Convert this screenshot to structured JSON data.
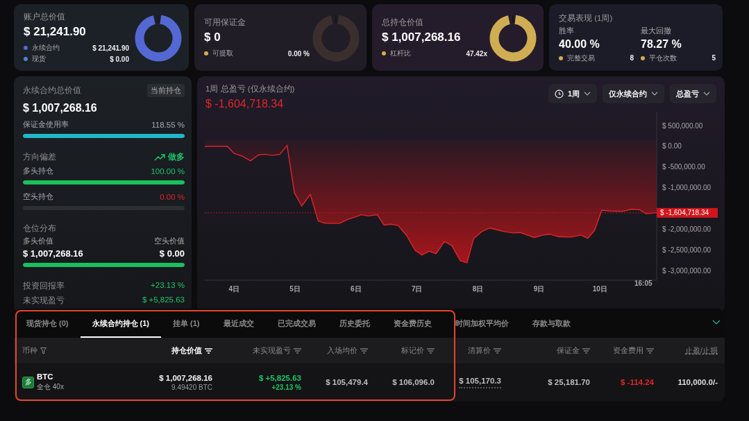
{
  "cards": [
    {
      "kind": "donut",
      "title": "账户总价值",
      "value": "$ 21,241.90",
      "legend": [
        {
          "label": "永续合约",
          "value": "$ 21,241.90",
          "color": "#5468d4"
        },
        {
          "label": "现货",
          "value": "$ 0.00",
          "color": "#4a86d8"
        }
      ]
    },
    {
      "kind": "donut",
      "title": "可用保证金",
      "value": "$ 0",
      "legend": [
        {
          "label": "可提取",
          "value": "0.00 %",
          "color": "#d4ad4f"
        }
      ]
    },
    {
      "kind": "donut",
      "title": "总持仓价值",
      "value": "$ 1,007,268.16",
      "legend": [
        {
          "label": "杠杆比",
          "value": "47.42x",
          "color": "#d4ad4f"
        }
      ]
    },
    {
      "kind": "stats",
      "title": "交易表现 (1周)",
      "metrics": [
        {
          "label": "胜率",
          "value": "40.00 %"
        },
        {
          "label": "最大回撤",
          "value": "78.27 %"
        }
      ],
      "legend": [
        {
          "label": "完整交易",
          "value": "8",
          "color": "#d4ad4f"
        },
        {
          "label": "平仓次数",
          "value": "5",
          "color": "#d4ad4f"
        }
      ]
    }
  ],
  "position_panel": {
    "title": "永续合约总价值",
    "tag": "当前持仓",
    "value": "$ 1,007,268.16",
    "margin_usage": {
      "label": "保证金使用率",
      "reading": "118.55 %",
      "level": 1
    },
    "direction": {
      "label": "方向偏差",
      "bias": "做多",
      "color": "#1ec46a",
      "long": {
        "label": "多头持仓",
        "reading": "100.00 %",
        "color": "#1ec46a",
        "level": 1
      },
      "short": {
        "label": "空头持仓",
        "reading": "0.00 %",
        "color": "#e0262a",
        "level": 0
      }
    },
    "distribution": {
      "label": "仓位分布",
      "long_label": "多头价值",
      "short_label": "空头价值",
      "long_value": "$ 1,007,268.16",
      "short_value": "$ 0.00",
      "level": 1
    },
    "stats": [
      {
        "label": "投资回报率",
        "value": "+23.13 %",
        "color": "#1ec46a"
      },
      {
        "label": "未实现盈亏",
        "value": "$ +5,825.63",
        "color": "#1ec46a"
      }
    ]
  },
  "pnl_chart": {
    "title": "1周 总盈亏 (仅永续合约)",
    "value": "$ -1,604,718.34",
    "color": "#e0262a",
    "filters": [
      {
        "label": "1周",
        "kind": "time"
      },
      {
        "label": "仅永续合约",
        "kind": "plain"
      },
      {
        "label": "总盈亏",
        "kind": "plain"
      }
    ],
    "chart_data": {
      "type": "line",
      "xlim": [
        3.52,
        10.93
      ],
      "ylim": [
        -3230000,
        820000
      ],
      "x": [
        3.52,
        3.89,
        4.0,
        4.14,
        4.27,
        4.4,
        4.51,
        4.62,
        4.75,
        4.87,
        4.99,
        5.11,
        5.25,
        5.38,
        5.5,
        5.73,
        5.87,
        5.98,
        6.09,
        6.21,
        6.35,
        6.46,
        6.57,
        6.69,
        6.83,
        6.97,
        7.08,
        7.2,
        7.31,
        7.45,
        7.57,
        7.71,
        7.82,
        7.93,
        8.07,
        8.19,
        8.33,
        8.44,
        8.58,
        8.7,
        8.81,
        8.92,
        9.07,
        9.18,
        9.32,
        9.52,
        9.69,
        9.8,
        9.91,
        10.03,
        10.17,
        10.37,
        10.51,
        10.65,
        10.76,
        10.93
      ],
      "series": [
        {
          "color": "#e0262a",
          "values": [
            0,
            0,
            -170000,
            -240000,
            -350000,
            -210000,
            -190000,
            -220000,
            -190000,
            20000,
            -1120000,
            -1440000,
            -1160000,
            -1800000,
            -1860000,
            -1860000,
            -1760000,
            -1710000,
            -1650000,
            -1680000,
            -1650000,
            -1900000,
            -1880000,
            -1910000,
            -2150000,
            -2510000,
            -2620000,
            -2530000,
            -2590000,
            -2300000,
            -2390000,
            -2760000,
            -2810000,
            -2220000,
            -2050000,
            -1970000,
            -2020000,
            -2060000,
            -2090000,
            -2080000,
            -2140000,
            -2200000,
            -2140000,
            -2120000,
            -2180000,
            -2190000,
            -2140000,
            -2220000,
            -2030000,
            -1540000,
            -1560000,
            -1570000,
            -1520000,
            -1530000,
            -1630000,
            -1600000
          ]
        }
      ],
      "xticks": [
        {
          "value": 4,
          "label": "4日"
        },
        {
          "value": 5,
          "label": "5日"
        },
        {
          "value": 6,
          "label": "6日"
        },
        {
          "value": 7,
          "label": "7日"
        },
        {
          "value": 8,
          "label": "8日"
        },
        {
          "value": 9,
          "label": "9日"
        },
        {
          "value": 10,
          "label": "10日"
        }
      ],
      "yticks": [
        {
          "value": 500000,
          "label": "$ 500,000.00"
        },
        {
          "value": 0,
          "label": "$ 0.00"
        },
        {
          "value": -500000,
          "label": "$ -500,000.00"
        },
        {
          "value": -1000000,
          "label": "$ -1,000,000.00"
        },
        {
          "value": -2000000,
          "label": "$ -2,000,000.00"
        },
        {
          "value": -2500000,
          "label": "$ -2,500,000.00"
        },
        {
          "value": -3000000,
          "label": "$ -3,000,000.00"
        }
      ],
      "ref_lines": [
        {
          "axis": "y",
          "value": -1604718.34,
          "label": "$ -1,604,718.34"
        }
      ]
    },
    "end_time": "16:05"
  },
  "positions": {
    "tabs": [
      {
        "label": "现货持仓 (0)",
        "selected": false
      },
      {
        "label": "永续合约持仓 (1)",
        "selected": true
      },
      {
        "label": "挂单 (1)",
        "selected": false
      },
      {
        "label": "最近成交",
        "selected": false
      },
      {
        "label": "已完成交易",
        "selected": false
      },
      {
        "label": "历史委托",
        "selected": false
      },
      {
        "label": "资金费历史",
        "selected": false
      },
      {
        "label": "时间加权平均价",
        "selected": false
      },
      {
        "label": "存款与取款",
        "selected": false
      }
    ],
    "columns": [
      {
        "label": "币种",
        "kind": "filter",
        "sorted": false
      },
      {
        "label": "持仓价值",
        "kind": "sort",
        "sorted": true
      },
      {
        "label": "未实现盈亏",
        "kind": "sort",
        "sorted": false
      },
      {
        "label": "入场均价",
        "kind": "sort",
        "sorted": false
      },
      {
        "label": "标记价",
        "kind": "sort",
        "sorted": false
      },
      {
        "label": "清算价",
        "kind": "sort",
        "sorted": false
      },
      {
        "label": "保证金",
        "kind": "sort",
        "sorted": false
      },
      {
        "label": "资金费用",
        "kind": "sort",
        "sorted": false
      },
      {
        "label": "止盈/止损",
        "kind": "plain",
        "sorted": false
      }
    ],
    "rows": [
      {
        "cells": [
          {
            "kind": "coin",
            "badge": "多",
            "text": "BTC",
            "sub": "全仓 40x"
          },
          {
            "kind": "value",
            "text": "$ 1,007,268.16",
            "sub": "9.49420 BTC",
            "color": "#f4f4f4"
          },
          {
            "kind": "value",
            "text": "$ +5,825.63",
            "sub": "+23.13 %",
            "color": "#1ec46a"
          },
          {
            "kind": "value",
            "text": "$ 105,479.4",
            "color": "#bdbdbd"
          },
          {
            "kind": "value",
            "text": "$ 106,096.0",
            "color": "#bdbdbd"
          },
          {
            "kind": "dotted",
            "text": "$ 105,170.3",
            "color": "#bdbdbd"
          },
          {
            "kind": "value",
            "text": "$ 25,181.70",
            "color": "#bdbdbd"
          },
          {
            "kind": "value",
            "text": "$ -114.24",
            "color": "#e0262a"
          },
          {
            "kind": "value",
            "text": "110,000.0/-",
            "color": "#dedede"
          }
        ]
      }
    ]
  }
}
